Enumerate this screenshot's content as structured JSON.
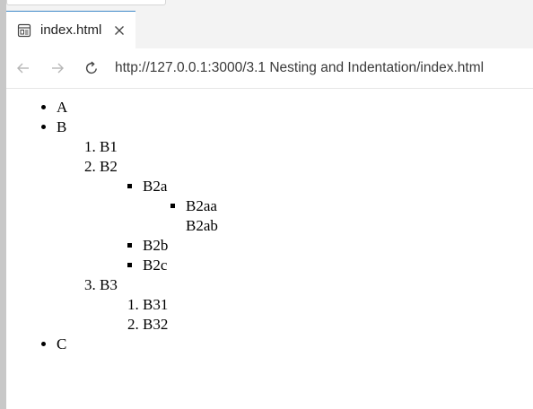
{
  "browser": {
    "tab": {
      "title": "index.html",
      "icon": "page-preview-icon",
      "close_icon": "close-icon"
    },
    "nav": {
      "back_icon": "back-arrow-icon",
      "forward_icon": "forward-arrow-icon",
      "reload_icon": "reload-icon"
    },
    "url": "http://127.0.0.1:3000/3.1 Nesting and Indentation/index.html",
    "colors": {
      "tab_accent": "#3f89c9",
      "chrome_bg": "#f3f3f3"
    }
  },
  "content": {
    "list": {
      "a": "A",
      "b": "B",
      "b1": "B1",
      "b2": "B2",
      "b2a": "B2a",
      "b2aa": "B2aa",
      "b2ab": "B2ab",
      "b2b": "B2b",
      "b2c": "B2c",
      "b3": "B3",
      "b31": "B31",
      "b32": "B32",
      "c": "C"
    }
  }
}
